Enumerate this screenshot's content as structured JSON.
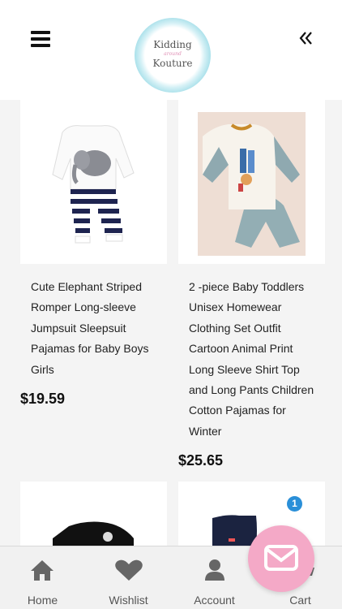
{
  "header": {
    "logo": {
      "line1": "Kidding",
      "line2": "around",
      "line3": "Kouture"
    },
    "menu_icon": "hamburger-menu-icon",
    "back_icon": "double-chevron-left-icon"
  },
  "products": [
    {
      "title_lines": [
        "Cute Elephant Striped",
        "Romper Long-sleeve",
        "Jumpsuit Sleepsuit",
        "Pajamas for Baby Boys",
        "Girls"
      ],
      "price": "$19.59"
    },
    {
      "title_lines": [
        "2 -piece Baby Toddlers",
        "Unisex Homewear",
        "Clothing Set Outfit",
        "Cartoon Animal Print",
        "Long Sleeve Shirt Top",
        "and Long Pants Children",
        "Cotton Pajamas for",
        "Winter"
      ],
      "price": "$25.65"
    }
  ],
  "cart_badge": "1",
  "nav": [
    {
      "label": "Home",
      "icon": "home-icon"
    },
    {
      "label": "Wishlist",
      "icon": "heart-icon"
    },
    {
      "label": "Account",
      "icon": "user-icon"
    },
    {
      "label": "Cart",
      "icon": "cart-icon"
    }
  ],
  "fab": {
    "icon": "mail-icon"
  },
  "colors": {
    "fab": "#f4a9c7",
    "badge": "#2a8fd8",
    "nav_bg": "#f1f1f1",
    "page_bg": "#f4f4f4"
  }
}
